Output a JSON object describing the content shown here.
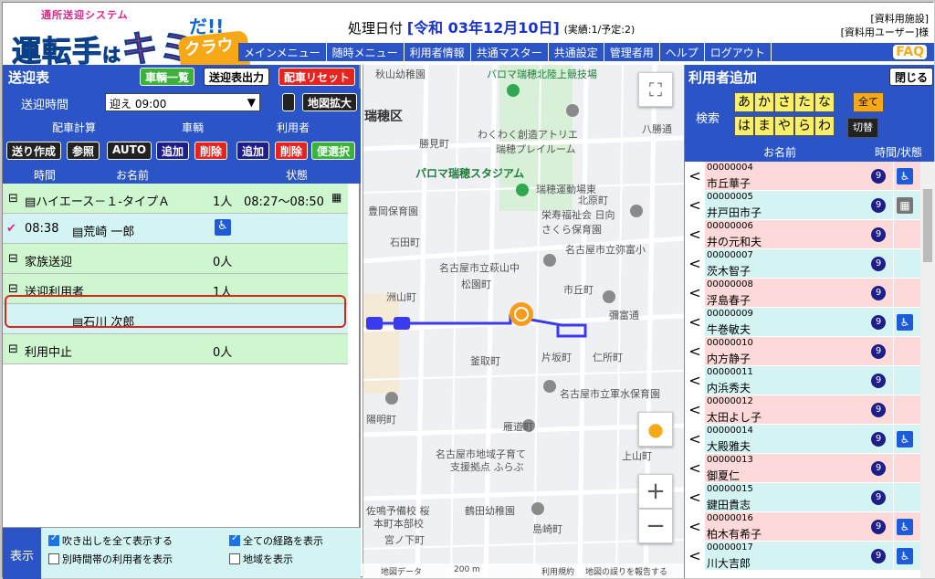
{
  "logo": {
    "sub": "通所送迎システム",
    "main_a": "運転手",
    "main_ha": "は",
    "main_kimi": "キミ",
    "main_da": "だ!!",
    "cloud": "クラウド"
  },
  "header": {
    "proc_label": "処理日付",
    "date": "[令和 03年12月10日]",
    "status": "(実績:1/予定:2)",
    "facility": "[資料用施設]",
    "user": "[資料用ユーザー]様"
  },
  "menu": [
    "メインメニュー",
    "随時メニュー",
    "利用者情報",
    "共通マスター",
    "共通設定",
    "管理者用",
    "ヘルプ",
    "ログアウト"
  ],
  "faq": "FAQ",
  "left": {
    "title": "送迎表",
    "btn_vehicles": "車輌一覧",
    "btn_output": "送迎表出力",
    "btn_reset": "配車リセット",
    "time_label": "送迎時間",
    "time_value": "迎え 09:00",
    "btn_mapzoom": "地図拡大",
    "h_calc": "配車計算",
    "h_vehicle": "車輌",
    "h_user": "利用者",
    "btn_make": "送り作成",
    "btn_ref": "参照",
    "btn_auto": "AUTO",
    "btn_add1": "追加",
    "btn_del1": "削除",
    "btn_add2": "追加",
    "btn_del2": "削除",
    "btn_convsel": "便選択",
    "col_time": "時間",
    "col_name": "お名前",
    "col_state": "状態",
    "rows": [
      {
        "mark": "⊟",
        "text": "ハイエース－１-タイプＡ",
        "count": "1人",
        "time": "08:27～08:50"
      },
      {
        "mark": "✔",
        "time2": "08:38",
        "text": "荒崎 一郎"
      },
      {
        "mark": "⊟",
        "text": "家族送迎",
        "count": "0人"
      },
      {
        "mark": "⊟",
        "text": "送迎利用者",
        "count": "1人"
      },
      {
        "text": "石川 次郎"
      },
      {
        "mark": "⊟",
        "text": "利用中止",
        "count": "0人"
      }
    ],
    "disp_label": "表示",
    "opt1": "吹き出しを全て表示する",
    "opt2": "全ての経路を表示",
    "opt3": "別時間帯の利用者を表示",
    "opt4": "地域を表示"
  },
  "map": {
    "labels": [
      "秋山幼稚園",
      "パロマ瑞穂北陸上競技場",
      "瑞穂区",
      "わくわく創造アトリエ",
      "瑞穂プレイルーム",
      "パロマ瑞穂スタジアム",
      "瑞穂運動場東",
      "豊岡保育園",
      "栄寿福祉会 日向",
      "さくら保育園",
      "石田町",
      "名古屋市立弥富小",
      "名古屋市立萩山中",
      "松園町",
      "洲山町",
      "市丘町",
      "彌富通",
      "釜取町",
      "片坂町",
      "仁所町",
      "名古屋市立軍水保育園",
      "名古屋市地域子育て",
      "支援拠点 ふらぶ",
      "佐鳴予備校 桜",
      "本町本部校",
      "鶴田幼稚園",
      "八勝通",
      "島崎町",
      "勝見町",
      "北原町",
      "陽明町",
      "雁道町",
      "上山町",
      "宮ノ下町"
    ],
    "attrib": "地図データ",
    "scale": "200 m",
    "terms": "利用規約",
    "report": "地図の誤りを報告する",
    "zoom_in": "+",
    "zoom_out": "−",
    "fullscreen": "⛶"
  },
  "right": {
    "title": "利用者追加",
    "btn_close": "閉じる",
    "search_label": "検索",
    "kana": [
      "あ",
      "か",
      "さ",
      "た",
      "な",
      "全て",
      "は",
      "ま",
      "や",
      "ら",
      "わ",
      "切替"
    ],
    "col_name": "お名前",
    "col_time": "時間/状態",
    "users": [
      {
        "id": "00000004",
        "name": "市丘華子",
        "wc": true
      },
      {
        "id": "00000005",
        "name": "井戸田市子",
        "wc": false,
        "other": true
      },
      {
        "id": "00000006",
        "name": "井の元和夫",
        "wc": false
      },
      {
        "id": "00000007",
        "name": "茨木智子",
        "wc": false
      },
      {
        "id": "00000008",
        "name": "浮島春子",
        "wc": false
      },
      {
        "id": "00000009",
        "name": "牛巻敏夫",
        "wc": true
      },
      {
        "id": "00000010",
        "name": "内方静子",
        "wc": false
      },
      {
        "id": "00000011",
        "name": "内浜秀夫",
        "wc": false
      },
      {
        "id": "00000012",
        "name": "太田よし子",
        "wc": false
      },
      {
        "id": "00000014",
        "name": "大殿雅夫",
        "wc": true
      },
      {
        "id": "00000013",
        "name": "御夏仁",
        "wc": false
      },
      {
        "id": "00000015",
        "name": "鍵田貴志",
        "wc": false
      },
      {
        "id": "00000016",
        "name": "柏木有希子",
        "wc": true
      },
      {
        "id": "00000017",
        "name": "川大吉郎",
        "wc": true
      }
    ]
  }
}
